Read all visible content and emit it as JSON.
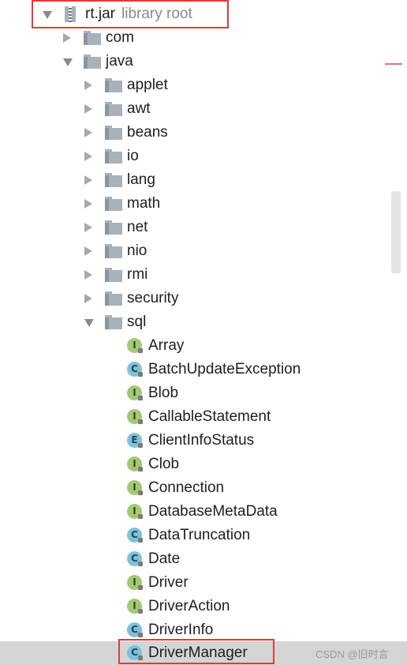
{
  "root": {
    "name": "rt.jar",
    "hint": "library root"
  },
  "packages": {
    "com": "com",
    "java": "java",
    "children": [
      "applet",
      "awt",
      "beans",
      "io",
      "lang",
      "math",
      "net",
      "nio",
      "rmi",
      "security"
    ],
    "sql": "sql"
  },
  "sql_items": [
    {
      "name": "Array",
      "kind": "I"
    },
    {
      "name": "BatchUpdateException",
      "kind": "C"
    },
    {
      "name": "Blob",
      "kind": "I"
    },
    {
      "name": "CallableStatement",
      "kind": "I"
    },
    {
      "name": "ClientInfoStatus",
      "kind": "E"
    },
    {
      "name": "Clob",
      "kind": "I"
    },
    {
      "name": "Connection",
      "kind": "I"
    },
    {
      "name": "DatabaseMetaData",
      "kind": "I"
    },
    {
      "name": "DataTruncation",
      "kind": "C"
    },
    {
      "name": "Date",
      "kind": "C"
    },
    {
      "name": "Driver",
      "kind": "I"
    },
    {
      "name": "DriverAction",
      "kind": "I"
    },
    {
      "name": "DriverInfo",
      "kind": "C"
    },
    {
      "name": "DriverManager",
      "kind": "C"
    }
  ],
  "watermark": "CSDN @旧时言",
  "colors": {
    "highlight_box": "#e03a3a",
    "interface_badge": "#a4c875",
    "class_badge": "#7fc2d8",
    "folder": "#a9b1ba"
  }
}
